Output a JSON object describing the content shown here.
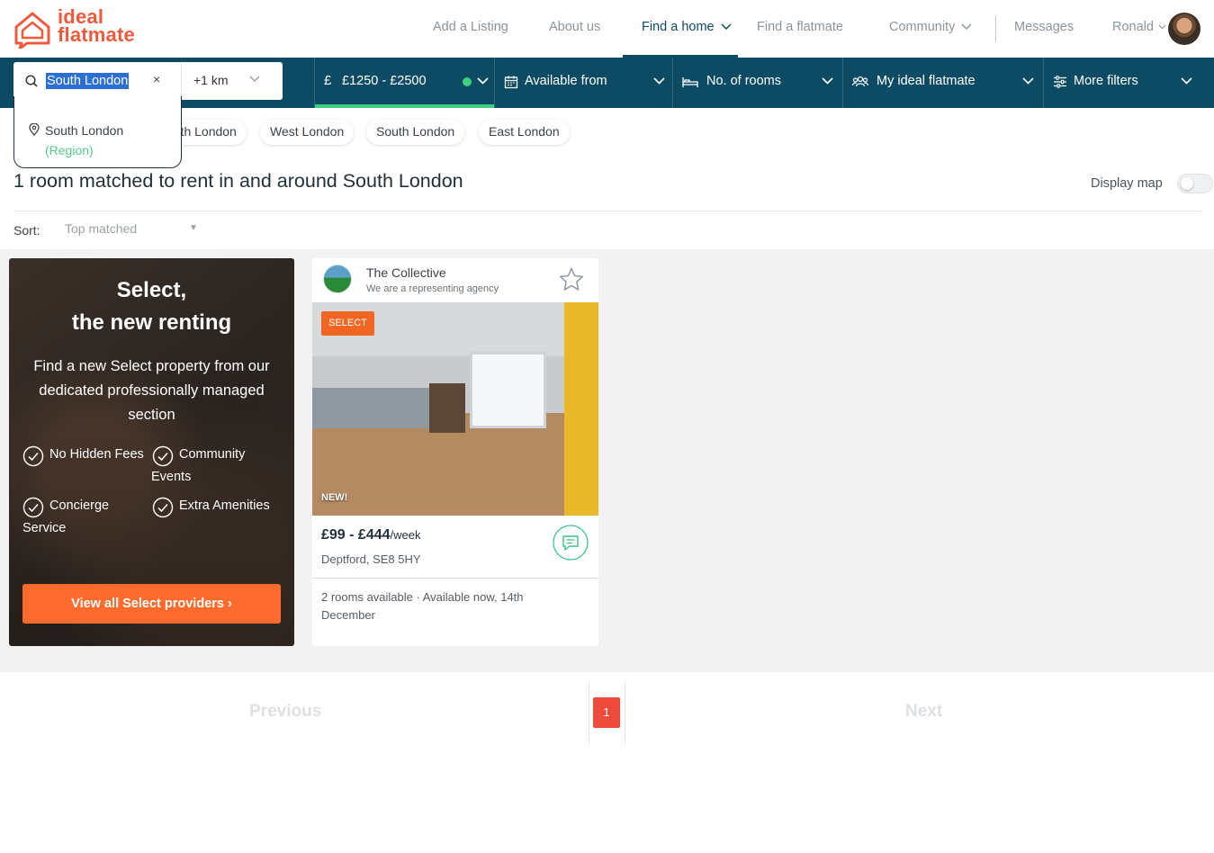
{
  "brand": {
    "line1": "ideal",
    "line2": "flatmate",
    "color": "#ef5a3c"
  },
  "nav": {
    "add_listing": "Add a Listing",
    "about": "About us",
    "find_home": "Find a home",
    "find_flatmate": "Find a flatmate",
    "community": "Community",
    "messages": "Messages",
    "user": "Ronald"
  },
  "filters": {
    "search_value": "South London",
    "clear": "×",
    "radius": "+1 km",
    "price": "£1250 - £2500",
    "available_from": "Available from",
    "rooms": "No. of rooms",
    "ideal_flatmate": "My ideal flatmate",
    "more": "More filters"
  },
  "autocomplete": {
    "name": "South London",
    "type": "(Region)"
  },
  "chips": [
    "North London",
    "West London",
    "South London",
    "East London"
  ],
  "results": {
    "title": "1 room matched to rent in and around South London",
    "display_map": "Display map",
    "sort_label": "Sort:",
    "sort_value": "Top matched"
  },
  "promo": {
    "title_line1": "Select,",
    "title_line2": "the new renting",
    "text": "Find a new Select property from our dedicated professionally managed section",
    "features": [
      "No Hidden Fees",
      "Community Events",
      "Concierge Service",
      "Extra Amenities"
    ],
    "button": "View all Select providers ›"
  },
  "listing": {
    "agency": "The Collective",
    "agency_sub": "We are a representing agency",
    "badge": "SELECT",
    "new": "NEW!",
    "price": "£99 - £444",
    "price_unit": "/week",
    "address": "Deptford, SE8 5HY",
    "availability": "2 rooms available · Available now, 14th December"
  },
  "pagination": {
    "previous": "Previous",
    "page": "1",
    "next": "Next"
  },
  "colors": {
    "navy": "#0d4a63",
    "green": "#3dd07d",
    "orange": "#ff6b2d"
  }
}
